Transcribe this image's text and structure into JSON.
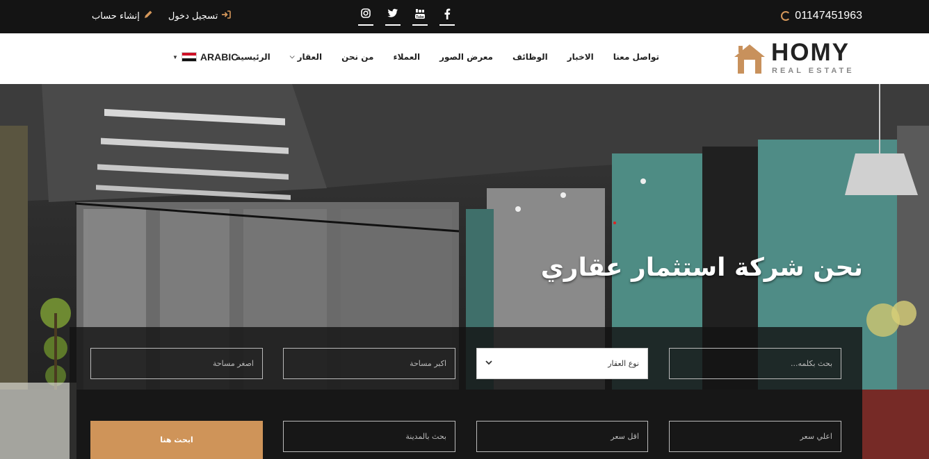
{
  "topbar": {
    "phone": "01147451963",
    "socials": [
      {
        "name": "facebook-icon",
        "glyph": "f"
      },
      {
        "name": "youtube-icon",
        "glyph": "▶"
      },
      {
        "name": "twitter-icon",
        "glyph": "t"
      },
      {
        "name": "instagram-icon",
        "glyph": "◎"
      }
    ],
    "login_label": "تسجيل دخول",
    "register_label": "إنشاء حساب"
  },
  "logo": {
    "title": "HOMY",
    "subtitle": "REAL ESTATE",
    "color": "#c8915c"
  },
  "nav": {
    "items": [
      {
        "label": "الرئيسية"
      },
      {
        "label": "العقار",
        "has_caret": true
      },
      {
        "label": "من نحن"
      },
      {
        "label": "العملاء"
      },
      {
        "label": "معرض الصور"
      },
      {
        "label": "الوظائف"
      },
      {
        "label": "الاخبار"
      },
      {
        "label": "تواصل معنا"
      }
    ],
    "language": "ARABIC"
  },
  "hero": {
    "title": "نحن شركة استثمار عقاري"
  },
  "search": {
    "keyword_placeholder": "بحث بكلمه...",
    "type_select_value": "نوع العقار",
    "max_area_placeholder": "اكبر مساحة",
    "min_area_placeholder": "اصغر مساحة",
    "max_price_placeholder": "اعلي سعر",
    "min_price_placeholder": "اقل سعر",
    "city_placeholder": "بحث بالمدينة",
    "submit_label": "ابحث هنا"
  },
  "colors": {
    "accent": "#cf9459",
    "topbar_bg": "#141414"
  }
}
